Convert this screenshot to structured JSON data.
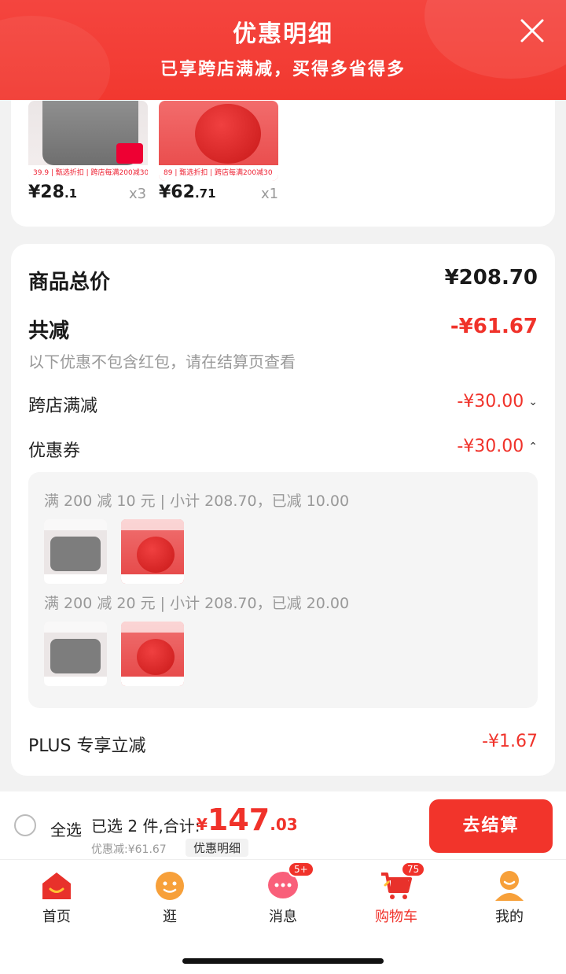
{
  "header": {
    "title": "优惠明细",
    "subtitle": "已享跨店满减，买得多省得多",
    "close_icon": "close-icon"
  },
  "products": [
    {
      "name": "grey-heating-pad",
      "thumb_price": "39.9 | 甄选折扣 | 跨店每满200减30",
      "price_int": "¥28",
      "price_dec": ".1",
      "qty": "x3"
    },
    {
      "name": "red-hand-warmer",
      "thumb_price": "89 | 甄选折扣 | 跨店每满200减30",
      "price_int": "¥62",
      "price_dec": ".71",
      "qty": "x1"
    }
  ],
  "summary": {
    "total_label": "商品总价",
    "total_value": "¥208.70",
    "reduce_label": "共减",
    "reduce_value": "-¥61.67",
    "note": "以下优惠不包含红包，请在结算页查看",
    "cross_store_label": "跨店满减",
    "cross_store_value": "-¥30.00",
    "coupon_label": "优惠券",
    "coupon_value": "-¥30.00",
    "coupon_lines": [
      "满 200 减 10 元 | 小计 208.70，已减 10.00",
      "满 200 减 20 元 | 小计 208.70，已减 20.00"
    ],
    "plus_label": "PLUS 专享立减",
    "plus_value": "-¥1.67"
  },
  "checkout": {
    "select_all": "全选",
    "selected_text": "已选 2 件,合计:",
    "total_currency": "¥",
    "total_int": "147",
    "total_dec": ".03",
    "discount_text": "优惠减:¥61.67",
    "detail_tag": "优惠明细",
    "pay_button": "去结算"
  },
  "tabbar": [
    {
      "label": "首页",
      "icon": "home-icon"
    },
    {
      "label": "逛",
      "icon": "stroll-icon"
    },
    {
      "label": "消息",
      "icon": "message-icon",
      "badge": "5+"
    },
    {
      "label": "购物车",
      "icon": "cart-icon",
      "badge": "75",
      "active": true
    },
    {
      "label": "我的",
      "icon": "profile-icon"
    }
  ],
  "colors": {
    "accent": "#f0322a",
    "header": "#f2382f"
  }
}
